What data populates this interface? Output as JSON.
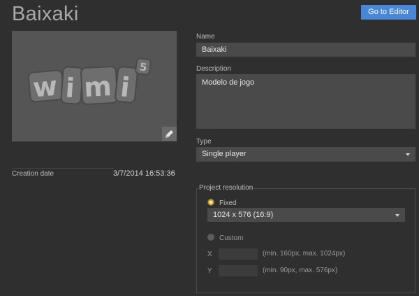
{
  "project": {
    "title": "Baixaki",
    "creation_date_label": "Creation date",
    "creation_date": "3/7/2014 16:53:36"
  },
  "toolbar": {
    "go_to_editor_label": "Go to Editor"
  },
  "thumbnail": {
    "logo_text": "wimi",
    "logo_sup": "5"
  },
  "form": {
    "name_label": "Name",
    "name_value": "Baixaki",
    "description_label": "Description",
    "description_value": "Modelo de jogo",
    "type_label": "Type",
    "type_value": "Single player"
  },
  "resolution": {
    "legend": "Project resolution",
    "fixed_label": "Fixed",
    "fixed_value": "1024 x 576 (16:9)",
    "custom_label": "Custom",
    "x_label": "X",
    "x_hint": "(min. 160px, max. 1024px)",
    "y_label": "Y",
    "y_hint": "(min. 90px, max. 576px)"
  },
  "colors": {
    "accent": "#4a86d8",
    "radio_selected": "#cfa73a",
    "background": "#2f2f2f"
  }
}
